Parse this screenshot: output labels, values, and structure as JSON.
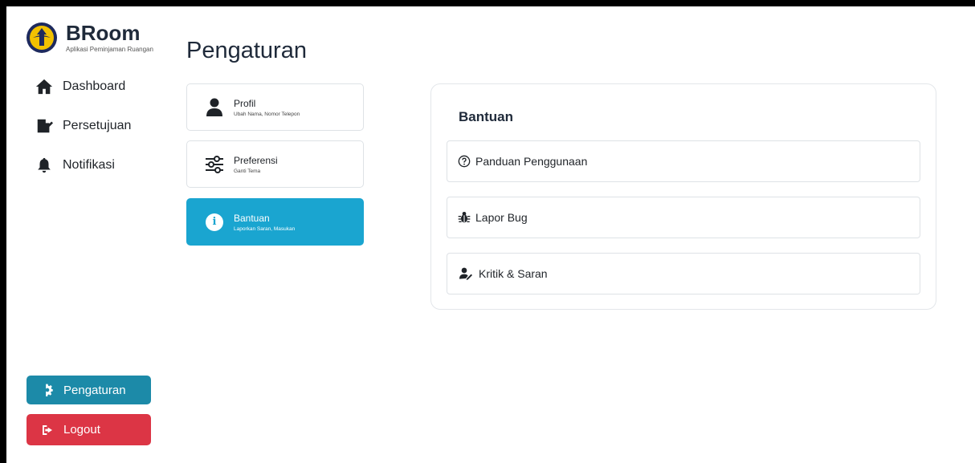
{
  "brand": {
    "name": "BRoom",
    "subtitle": "Aplikasi Peminjaman Ruangan"
  },
  "nav": [
    {
      "label": "Dashboard",
      "icon": "home-icon"
    },
    {
      "label": "Persetujuan",
      "icon": "signature-icon"
    },
    {
      "label": "Notifikasi",
      "icon": "bell-icon"
    }
  ],
  "sidebar_buttons": {
    "settings": {
      "label": "Pengaturan",
      "icon": "gear-icon",
      "color": "#1c8aa8"
    },
    "logout": {
      "label": "Logout",
      "icon": "sign-out-icon",
      "color": "#dc3545"
    }
  },
  "page": {
    "title": "Pengaturan"
  },
  "settings_menu": [
    {
      "title": "Profil",
      "subtitle": "Ubah Nama, Nomor Telepon",
      "icon": "user-icon"
    },
    {
      "title": "Preferensi",
      "subtitle": "Ganti Tema",
      "icon": "sliders-icon"
    },
    {
      "title": "Bantuan",
      "subtitle": "Laporkan Saran, Masukan",
      "icon": "info-icon",
      "active": true
    }
  ],
  "help_panel": {
    "title": "Bantuan",
    "items": [
      {
        "label": "Panduan Penggunaan",
        "icon": "question-circle-icon"
      },
      {
        "label": "Lapor Bug",
        "icon": "bug-icon"
      },
      {
        "label": "Kritik & Saran",
        "icon": "user-pen-icon"
      }
    ]
  },
  "colors": {
    "accent": "#1aa5d0",
    "danger": "#dc3545",
    "teal": "#1c8aa8"
  }
}
